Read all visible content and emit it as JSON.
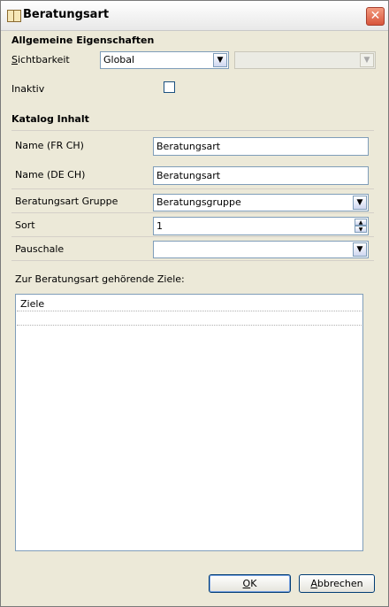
{
  "window": {
    "title": "Beratungsart",
    "close_glyph": "✕"
  },
  "general": {
    "heading": "Allgemeine Eigenschaften",
    "visibility_label_first": "S",
    "visibility_label_rest": "ichtbarkeit",
    "visibility_value": "Global",
    "secondary_value": "",
    "inactive_label": "Inaktiv",
    "inactive_checked": false
  },
  "catalog": {
    "heading": "Katalog Inhalt",
    "name_fr_label": "Name (FR CH)",
    "name_fr_value": "Beratungsart",
    "name_de_label": "Name (DE CH)",
    "name_de_value": "Beratungsart",
    "group_label": "Beratungsart Gruppe",
    "group_value": "Beratungsgruppe",
    "sort_label": "Sort",
    "sort_value": "1",
    "flatrate_label": "Pauschale",
    "flatrate_value": ""
  },
  "goals": {
    "caption": "Zur Beratungsart gehörende Ziele:",
    "column_header": "Ziele"
  },
  "buttons": {
    "ok_first": "O",
    "ok_rest": "K",
    "cancel_first": "A",
    "cancel_rest": "bbrechen"
  },
  "icons": {
    "dropdown": "▼",
    "spin_up": "▲",
    "spin_down": "▼"
  }
}
